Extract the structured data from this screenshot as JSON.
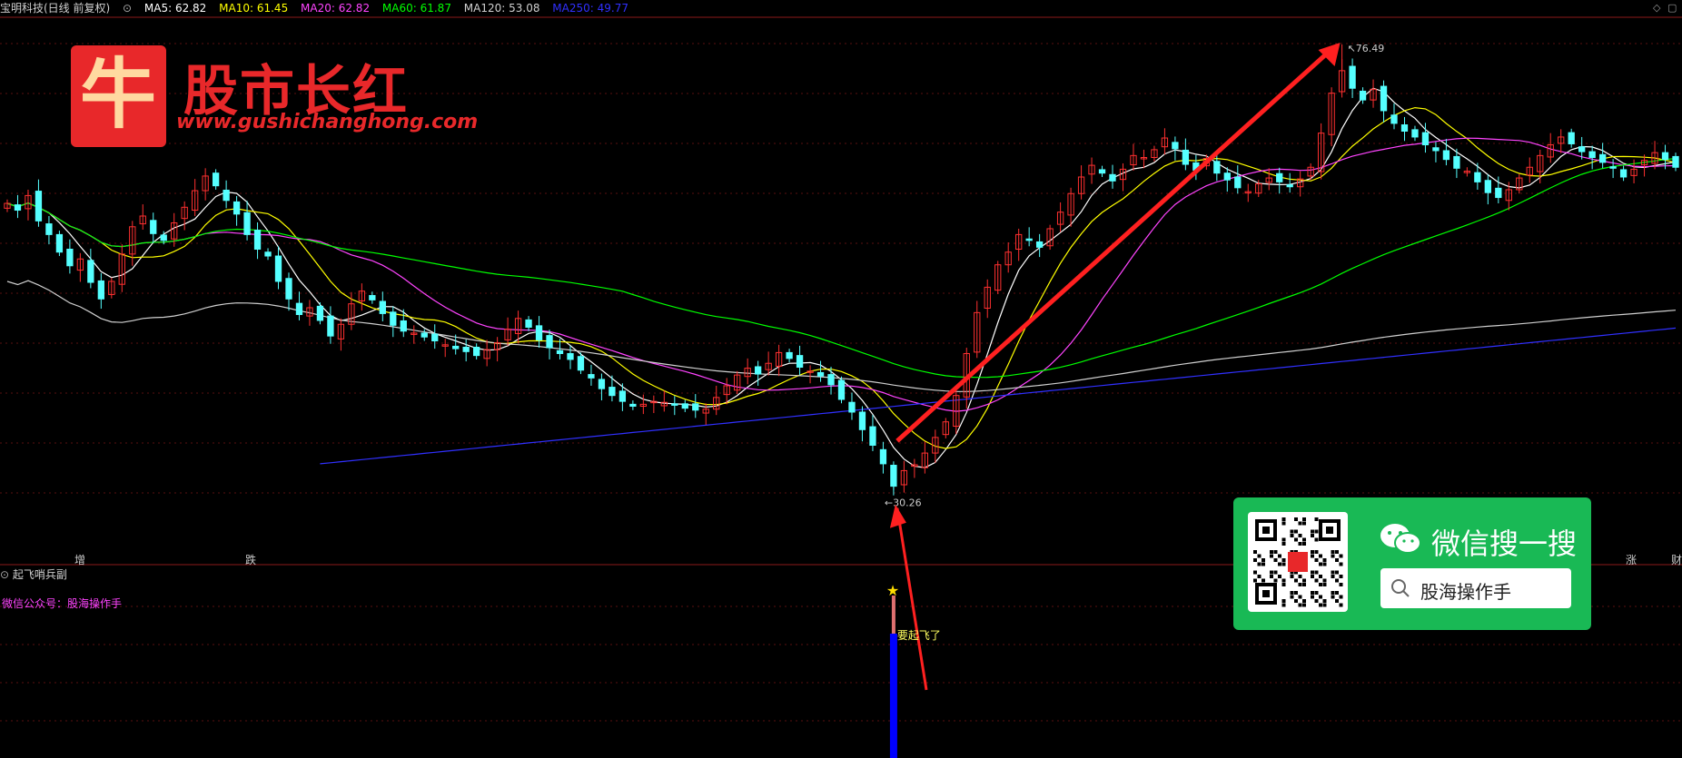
{
  "header": {
    "stock_label": "宝明科技(日线 前复权)",
    "ma_items": [
      {
        "label": "MA5: 62.82",
        "color": "#ffffff"
      },
      {
        "label": "MA10: 61.45",
        "color": "#ffff00"
      },
      {
        "label": "MA20: 62.82",
        "color": "#ff44ff"
      },
      {
        "label": "MA60: 61.87",
        "color": "#00ff00"
      },
      {
        "label": "MA120: 53.08",
        "color": "#d0d0d0"
      },
      {
        "label": "MA250: 49.77",
        "color": "#3030ff"
      }
    ],
    "corner_icons": [
      "diamond-icon",
      "window-icon"
    ]
  },
  "logo": {
    "title": "股市长红",
    "url": "www.gushichanghong.com",
    "mark": "牛"
  },
  "annotations": {
    "high_label": "76.49",
    "low_label": "30.26",
    "signal_text": "要起飞了"
  },
  "event_tags": [
    {
      "text": "增",
      "color": "#ff3030"
    },
    {
      "text": "跌",
      "color": "#00e000"
    },
    {
      "text": "涨",
      "color": "#ff3030"
    },
    {
      "text": "财",
      "color": "#3090ff"
    }
  ],
  "sub_panel": {
    "title": "起飞哨兵副",
    "wechat_label": "微信公众号：股海操作手"
  },
  "wechat_card": {
    "title": "微信搜一搜",
    "search_text": "股海操作手"
  },
  "chart_data": {
    "type": "candlestick",
    "high": 76.49,
    "low": 30.26,
    "ma_colors": {
      "MA5": "#ffffff",
      "MA10": "#ffff00",
      "MA20": "#ff44ff",
      "MA60": "#00ff00",
      "MA120": "#d0d0d0",
      "MA250": "#3030ff"
    },
    "up_color": "#ff3030",
    "down_color": "#55ffff",
    "closes": [
      60.2,
      59.5,
      61.0,
      58.4,
      57.0,
      55.2,
      53.8,
      54.5,
      52.1,
      50.4,
      52.2,
      55.0,
      57.8,
      58.9,
      57.1,
      56.4,
      58.2,
      59.8,
      61.5,
      63.0,
      62.0,
      60.5,
      59.1,
      57.0,
      55.5,
      54.8,
      52.2,
      50.4,
      48.8,
      49.5,
      48.2,
      46.6,
      47.8,
      49.9,
      51.2,
      50.3,
      48.9,
      47.7,
      47.1,
      46.9,
      46.5,
      46.1,
      45.7,
      45.3,
      45.0,
      44.6,
      45.2,
      45.9,
      47.3,
      48.4,
      47.5,
      46.2,
      45.4,
      44.8,
      44.2,
      43.1,
      42.3,
      41.2,
      40.5,
      39.9,
      39.4,
      39.6,
      39.9,
      39.8,
      39.5,
      39.2,
      39.0,
      39.1,
      40.3,
      41.5,
      42.6,
      43.3,
      42.7,
      43.8,
      44.9,
      44.3,
      43.4,
      43.0,
      42.5,
      41.6,
      40.1,
      38.8,
      37.0,
      35.4,
      33.5,
      31.2,
      32.8,
      33.4,
      34.6,
      36.2,
      37.8,
      40.5,
      44.8,
      49.0,
      51.6,
      53.9,
      55.2,
      57.0,
      56.4,
      55.7,
      57.6,
      59.3,
      61.2,
      62.9,
      64.1,
      63.3,
      62.5,
      63.7,
      65.1,
      64.9,
      65.7,
      66.9,
      65.8,
      64.2,
      63.6,
      64.8,
      63.3,
      62.6,
      61.8,
      61.4,
      62.2,
      62.8,
      62.4,
      61.9,
      62.7,
      63.9,
      67.4,
      71.5,
      73.8,
      72.0,
      70.8,
      71.9,
      69.7,
      68.4,
      67.6,
      67.0,
      66.2,
      65.6,
      64.7,
      63.8,
      63.5,
      62.4,
      61.3,
      60.8,
      61.6,
      62.8,
      63.9,
      65.1,
      66.2,
      67.0,
      66.3,
      65.5,
      64.9,
      64.4,
      63.8,
      62.9,
      63.7,
      64.6,
      65.4,
      64.7,
      63.9
    ]
  }
}
